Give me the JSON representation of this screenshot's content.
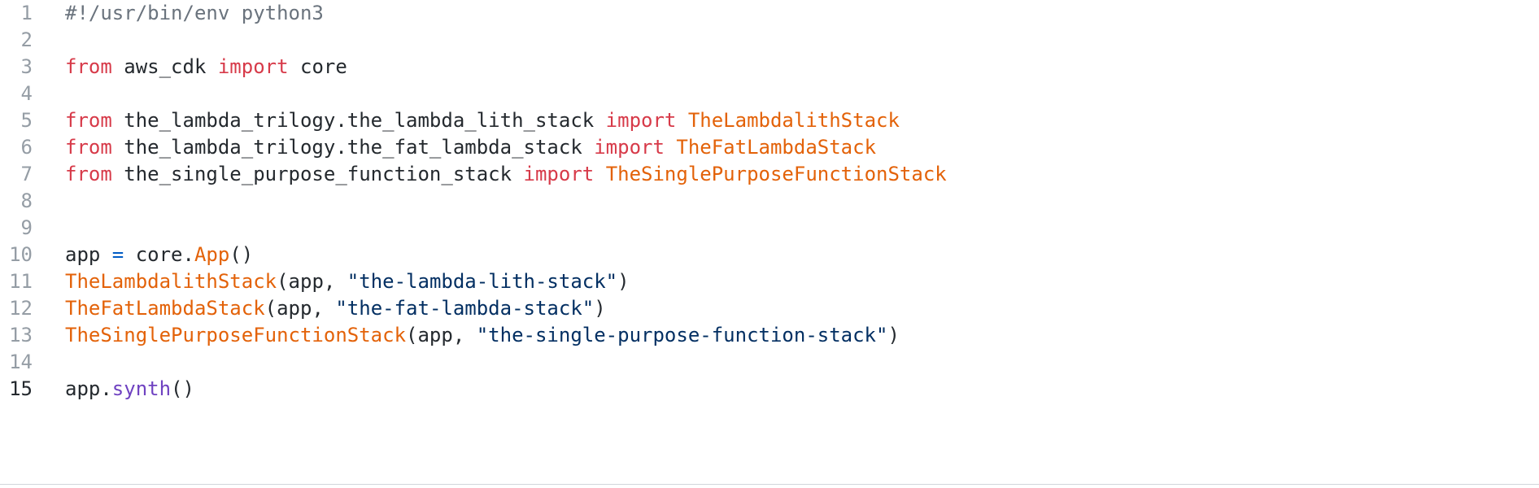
{
  "editor": {
    "lines": [
      {
        "number": "1",
        "tokens": [
          {
            "text": "#!/usr/bin/env python3",
            "kind": "comment"
          }
        ]
      },
      {
        "number": "2",
        "tokens": []
      },
      {
        "number": "3",
        "tokens": [
          {
            "text": "from",
            "kind": "keyword"
          },
          {
            "text": " aws_cdk ",
            "kind": "plain"
          },
          {
            "text": "import",
            "kind": "keyword"
          },
          {
            "text": " core",
            "kind": "plain"
          }
        ]
      },
      {
        "number": "4",
        "tokens": []
      },
      {
        "number": "5",
        "tokens": [
          {
            "text": "from",
            "kind": "keyword"
          },
          {
            "text": " the_lambda_trilogy.the_lambda_lith_stack ",
            "kind": "plain"
          },
          {
            "text": "import",
            "kind": "keyword"
          },
          {
            "text": " ",
            "kind": "plain"
          },
          {
            "text": "TheLambdalithStack",
            "kind": "class"
          }
        ]
      },
      {
        "number": "6",
        "tokens": [
          {
            "text": "from",
            "kind": "keyword"
          },
          {
            "text": " the_lambda_trilogy.the_fat_lambda_stack ",
            "kind": "plain"
          },
          {
            "text": "import",
            "kind": "keyword"
          },
          {
            "text": " ",
            "kind": "plain"
          },
          {
            "text": "TheFatLambdaStack",
            "kind": "class"
          }
        ]
      },
      {
        "number": "7",
        "tokens": [
          {
            "text": "from",
            "kind": "keyword"
          },
          {
            "text": " the_single_purpose_function_stack ",
            "kind": "plain"
          },
          {
            "text": "import",
            "kind": "keyword"
          },
          {
            "text": " ",
            "kind": "plain"
          },
          {
            "text": "TheSinglePurposeFunctionStack",
            "kind": "class"
          }
        ]
      },
      {
        "number": "8",
        "tokens": []
      },
      {
        "number": "9",
        "tokens": []
      },
      {
        "number": "10",
        "tokens": [
          {
            "text": "app ",
            "kind": "plain"
          },
          {
            "text": "=",
            "kind": "operator"
          },
          {
            "text": " core.",
            "kind": "plain"
          },
          {
            "text": "App",
            "kind": "class"
          },
          {
            "text": "()",
            "kind": "plain"
          }
        ]
      },
      {
        "number": "11",
        "tokens": [
          {
            "text": "TheLambdalithStack",
            "kind": "class"
          },
          {
            "text": "(app, ",
            "kind": "plain"
          },
          {
            "text": "\"the-lambda-lith-stack\"",
            "kind": "string"
          },
          {
            "text": ")",
            "kind": "plain"
          }
        ]
      },
      {
        "number": "12",
        "tokens": [
          {
            "text": "TheFatLambdaStack",
            "kind": "class"
          },
          {
            "text": "(app, ",
            "kind": "plain"
          },
          {
            "text": "\"the-fat-lambda-stack\"",
            "kind": "string"
          },
          {
            "text": ")",
            "kind": "plain"
          }
        ]
      },
      {
        "number": "13",
        "tokens": [
          {
            "text": "TheSinglePurposeFunctionStack",
            "kind": "class"
          },
          {
            "text": "(app, ",
            "kind": "plain"
          },
          {
            "text": "\"the-single-purpose-function-stack\"",
            "kind": "string"
          },
          {
            "text": ")",
            "kind": "plain"
          }
        ]
      },
      {
        "number": "14",
        "tokens": []
      },
      {
        "number": "15",
        "current": true,
        "tokens": [
          {
            "text": "app.",
            "kind": "plain"
          },
          {
            "text": "synth",
            "kind": "method"
          },
          {
            "text": "()",
            "kind": "plain"
          }
        ]
      }
    ]
  }
}
